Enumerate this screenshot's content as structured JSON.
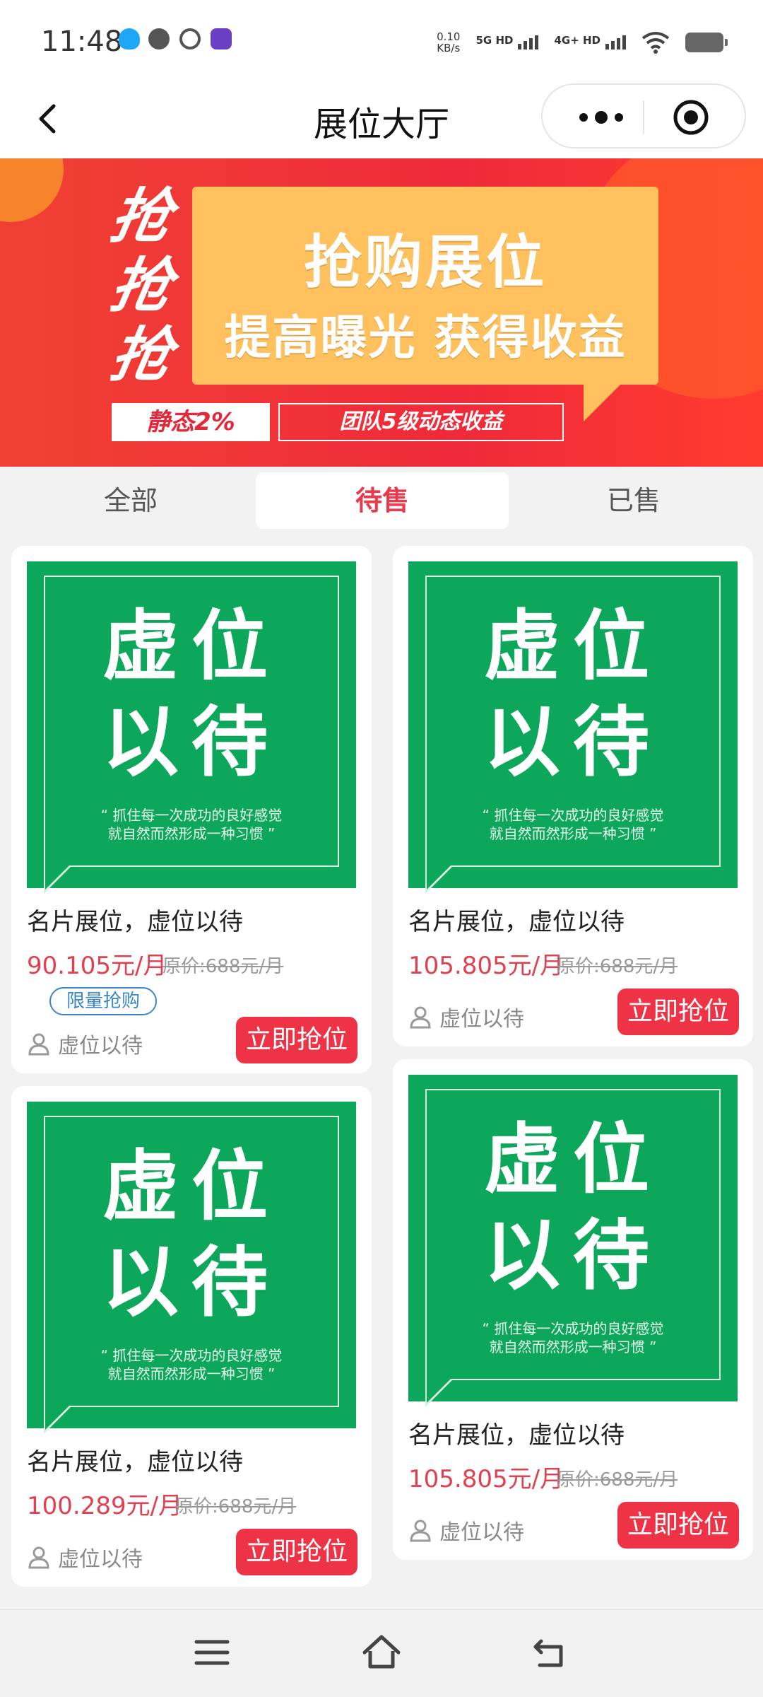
{
  "status_bar": {
    "time": "11:48",
    "speed_value": "0.10",
    "speed_unit": "KB/s",
    "sig1_label": "5G HD",
    "sig2_label": "4G+ HD",
    "app_icons": [
      "qq-icon",
      "wechat-icon",
      "sync-icon",
      "app-badge-icon"
    ]
  },
  "nav": {
    "title": "展位大厅"
  },
  "banner": {
    "qiang": [
      "抢",
      "抢",
      "抢"
    ],
    "headline": "抢购展位",
    "subline": "提高曝光 获得收益",
    "tag_left": "静态2%",
    "tag_right": "团队5级动态收益"
  },
  "tabs": [
    {
      "label": "全部",
      "active": false
    },
    {
      "label": "待售",
      "active": true
    },
    {
      "label": "已售",
      "active": false
    }
  ],
  "cards": [
    {
      "image": {
        "line1": "虚位",
        "line2": "以待",
        "quote1": "“ 抓住每一次成功的良好感觉",
        "quote2": "就自然而然形成一种习惯 ”"
      },
      "name": "名片展位，虚位以待",
      "price": "90.105元/月",
      "original": "原价:688元/月",
      "badge": "限量抢购",
      "seller": "虚位以待",
      "button": "立即抢位"
    },
    {
      "image": {
        "line1": "虚位",
        "line2": "以待",
        "quote1": "“ 抓住每一次成功的良好感觉",
        "quote2": "就自然而然形成一种习惯 ”"
      },
      "name": "名片展位，虚位以待",
      "price": "105.805元/月",
      "original": "原价:688元/月",
      "seller": "虚位以待",
      "button": "立即抢位"
    },
    {
      "image": {
        "line1": "虚位",
        "line2": "以待",
        "quote1": "“ 抓住每一次成功的良好感觉",
        "quote2": "就自然而然形成一种习惯 ”"
      },
      "name": "名片展位，虚位以待",
      "price": "100.289元/月",
      "original": "原价:688元/月",
      "seller": "虚位以待",
      "button": "立即抢位"
    },
    {
      "image": {
        "line1": "虚位",
        "line2": "以待",
        "quote1": "“ 抓住每一次成功的良好感觉",
        "quote2": "就自然而然形成一种习惯 ”"
      },
      "name": "名片展位，虚位以待",
      "price": "105.805元/月",
      "original": "原价:688元/月",
      "seller": "虚位以待",
      "button": "立即抢位"
    }
  ],
  "colors": {
    "accent": "#e9394b",
    "banner_red": "#ef2a3a",
    "card_green": "#0da75c",
    "badge_blue": "#3a86c8"
  },
  "system_nav": [
    "menu-icon",
    "home-icon",
    "back-return-icon"
  ]
}
